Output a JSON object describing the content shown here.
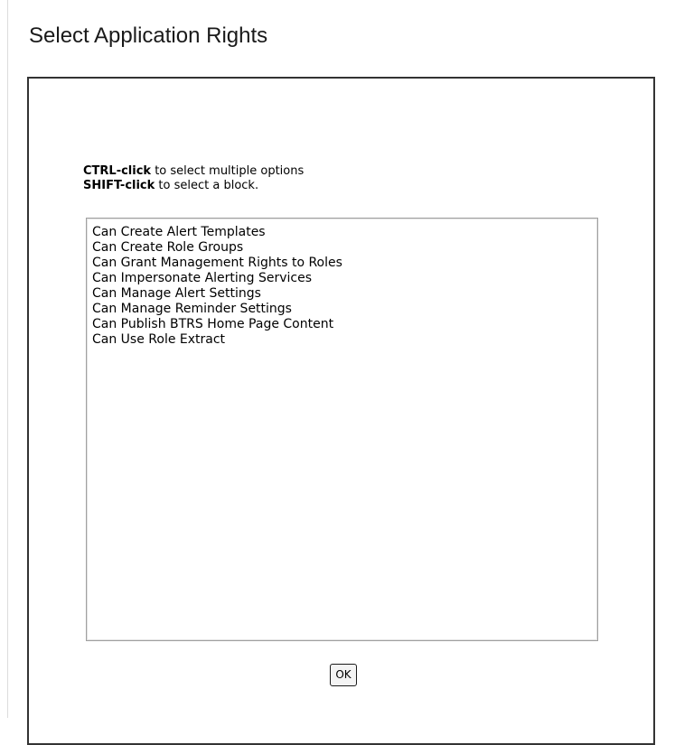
{
  "page": {
    "title": "Select Application Rights"
  },
  "instructions": {
    "ctrl_key": "CTRL-click",
    "ctrl_text": " to select multiple options",
    "shift_key": "SHIFT-click",
    "shift_text": " to select a block."
  },
  "rights_list": {
    "options": [
      "Can Create Alert Templates",
      "Can Create Role Groups",
      "Can Grant Management Rights to Roles",
      "Can Impersonate Alerting Services",
      "Can Manage Alert Settings",
      "Can Manage Reminder Settings",
      "Can Publish BTRS Home Page Content",
      "Can Use Role Extract"
    ]
  },
  "actions": {
    "ok_label": "OK"
  }
}
